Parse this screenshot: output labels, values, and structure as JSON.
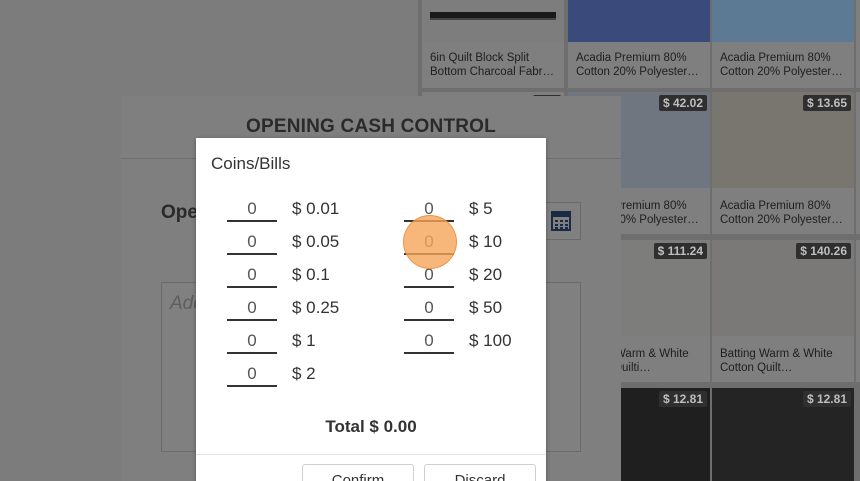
{
  "products": [
    {
      "name": "6in Quilt Block Split Bottom Charcoal Fabr…",
      "price": ""
    },
    {
      "name": "Acadia Premium 80% Cotton 20% Polyester…",
      "price": ""
    },
    {
      "name": "Acadia Premium 80% Cotton 20% Polyester…",
      "price": ""
    },
    {
      "name": "",
      "price": ""
    },
    {
      "name": "Acadia Premium 80% Cotton 20% Polyester…",
      "price": "$ 42.02"
    },
    {
      "name": "Acadia Premium 80% Cotton 20% Polyester…",
      "price": "$ 13.65"
    },
    {
      "name": "",
      "price": ""
    },
    {
      "name": "Batting Warm & White Cotton Quilti…",
      "price": "$ 111.24"
    },
    {
      "name": "Batting Warm & White Cotton Quilt…",
      "price": "$ 140.26"
    },
    {
      "name": "",
      "price": ""
    },
    {
      "name": "",
      "price": "$ 12.81"
    },
    {
      "name": "",
      "price": "$ 12.81"
    }
  ],
  "modal": {
    "title": "OPENING CASH CONTROL",
    "label": "Ope",
    "notes_placeholder": "Add"
  },
  "coins": {
    "title": "Coins/Bills",
    "left": [
      {
        "qty": "0",
        "denom": "$ 0.01"
      },
      {
        "qty": "0",
        "denom": "$ 0.05"
      },
      {
        "qty": "0",
        "denom": "$ 0.1"
      },
      {
        "qty": "0",
        "denom": "$ 0.25"
      },
      {
        "qty": "0",
        "denom": "$ 1"
      },
      {
        "qty": "0",
        "denom": "$ 2"
      }
    ],
    "right": [
      {
        "qty": "0",
        "denom": "$ 5"
      },
      {
        "qty": "0",
        "denom": "$ 10"
      },
      {
        "qty": "0",
        "denom": "$ 20"
      },
      {
        "qty": "0",
        "denom": "$ 50"
      },
      {
        "qty": "0",
        "denom": "$ 100"
      }
    ],
    "total": "Total $ 0.00",
    "confirm_label": "Confirm",
    "discard_label": "Discard"
  }
}
